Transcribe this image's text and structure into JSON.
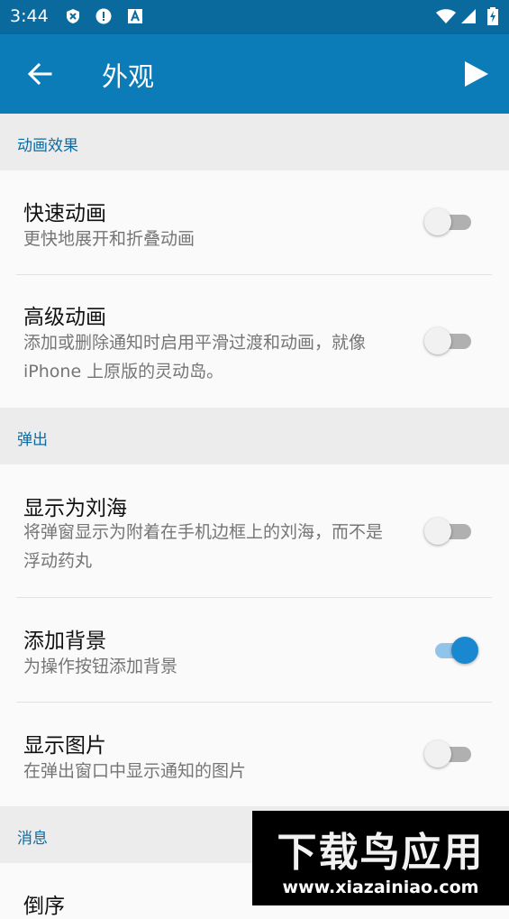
{
  "status_bar": {
    "time": "3:44",
    "icons": [
      "shield-x-icon",
      "alert-circle-icon",
      "a-square-icon",
      "wifi-icon",
      "signal-icon",
      "battery-charging-icon"
    ]
  },
  "app_bar": {
    "title": "外观",
    "back_icon": "arrow-back-icon",
    "action_icon": "play-icon"
  },
  "sections": {
    "animation": {
      "header": "动画效果",
      "items": [
        {
          "title": "快速动画",
          "subtitle": "更快地展开和折叠动画",
          "on": false
        },
        {
          "title": "高级动画",
          "subtitle": "添加或删除通知时启用平滑过渡和动画，就像 iPhone 上原版的灵动岛。",
          "on": false
        }
      ]
    },
    "popup": {
      "header": "弹出",
      "items": [
        {
          "title": "显示为刘海",
          "subtitle": "将弹窗显示为附着在手机边框上的刘海，而不是浮动药丸",
          "on": false
        },
        {
          "title": "添加背景",
          "subtitle": "为操作按钮添加背景",
          "on": true
        },
        {
          "title": "显示图片",
          "subtitle": "在弹出窗口中显示通知的图片",
          "on": false
        }
      ]
    },
    "message": {
      "header": "消息",
      "items": [
        {
          "title": "倒序"
        }
      ]
    }
  },
  "watermark": {
    "title": "下载鸟应用",
    "url": "www.xiazainiao.com"
  },
  "colors": {
    "status_bar": "#0a6a9e",
    "app_bar": "#0c7cb8",
    "accent": "#1a88d0",
    "section_text": "#0f6aa0"
  }
}
